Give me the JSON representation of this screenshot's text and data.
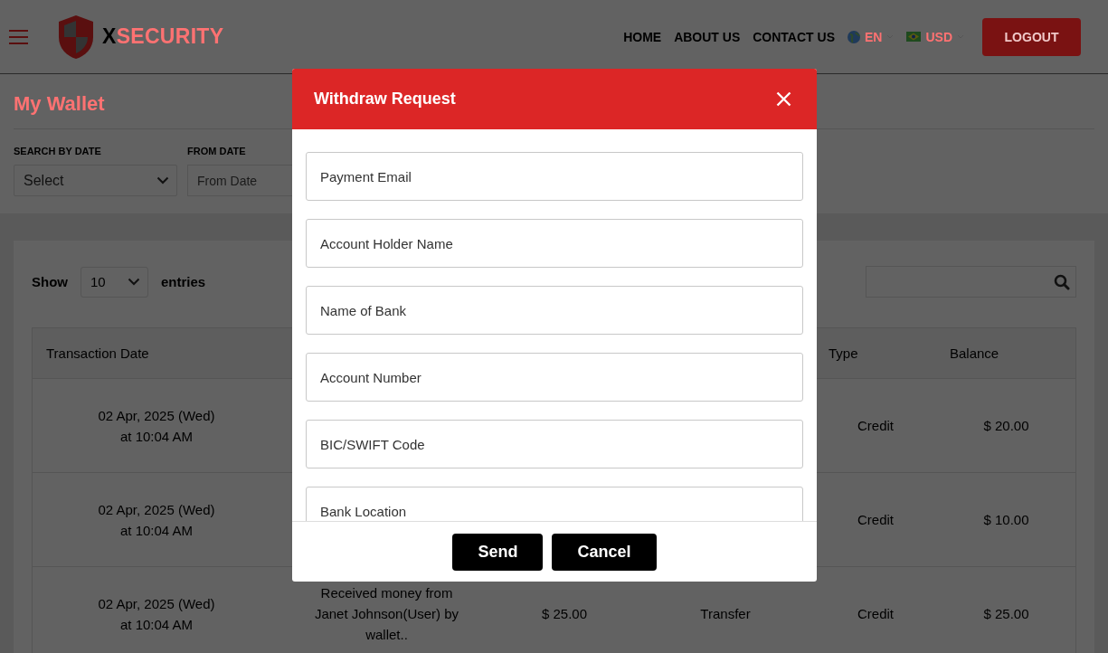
{
  "header": {
    "logo": {
      "prefix": "X",
      "rest": "SECURITY"
    },
    "nav": [
      "HOME",
      "ABOUT US",
      "CONTACT US"
    ],
    "language": "EN",
    "currency": "USD",
    "logout": "LOGOUT"
  },
  "page_title": "My Wallet",
  "filters": [
    {
      "label": "SEARCH BY DATE",
      "kind": "select",
      "value": "Select"
    },
    {
      "label": "FROM DATE",
      "kind": "date",
      "placeholder": "From Date"
    }
  ],
  "entries": {
    "show": "Show",
    "value": "10",
    "suffix": "entries"
  },
  "table": {
    "columns": {
      "column_1": "Transaction Date",
      "column_5": "Type",
      "column_6": "Balance"
    },
    "rows": [
      {
        "column_1": "02 Apr, 2025 (Wed)\nat 10:04 AM",
        "column_5": "Credit",
        "column_6": "$ 20.00"
      },
      {
        "column_1": "02 Apr, 2025 (Wed)\nat 10:04 AM",
        "column_5": "Credit",
        "column_6": "$ 10.00"
      },
      {
        "column_1": "02 Apr, 2025 (Wed)\nat 10:04 AM",
        "column_2": "Received money from\nJanet Johnson(User) by\nwallet..",
        "column_3": "$ 25.00",
        "column_4": "Transfer",
        "column_5": "Credit",
        "column_6": "$ 25.00"
      }
    ]
  },
  "modal": {
    "title": "Withdraw Request",
    "fields": [
      {
        "placeholder": "Payment Email"
      },
      {
        "placeholder": "Account Holder Name"
      },
      {
        "placeholder": "Name of Bank"
      },
      {
        "placeholder": "Account Number"
      },
      {
        "placeholder": "BIC/SWIFT Code"
      },
      {
        "placeholder": "Bank Location"
      }
    ],
    "buttons": [
      "Send",
      "Cancel"
    ]
  }
}
